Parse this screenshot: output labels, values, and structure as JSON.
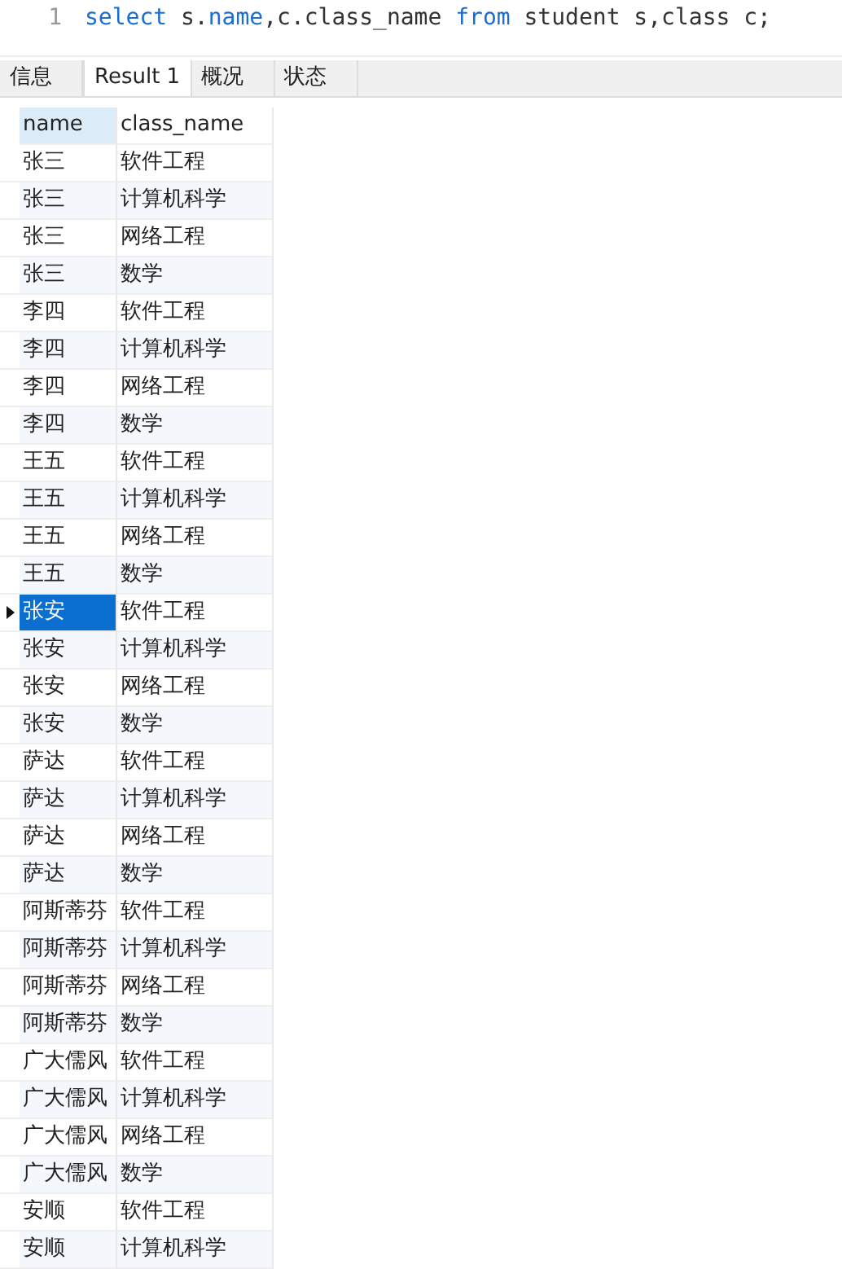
{
  "editor": {
    "line_number": "1",
    "code": [
      {
        "kind": "keyword",
        "text": "select"
      },
      {
        "kind": "plain",
        "text": " s."
      },
      {
        "kind": "keyword",
        "text": "name"
      },
      {
        "kind": "plain",
        "text": ",c.class_name "
      },
      {
        "kind": "keyword",
        "text": "from"
      },
      {
        "kind": "plain",
        "text": " student s,"
      },
      {
        "kind": "plain",
        "text": "class c;"
      }
    ]
  },
  "tabs": [
    {
      "label": "信息",
      "selected": false
    },
    {
      "label": "Result 1",
      "selected": true
    },
    {
      "label": "概况",
      "selected": false
    },
    {
      "label": "状态",
      "selected": false
    }
  ],
  "table": {
    "columns": [
      "name",
      "class_name"
    ],
    "rows": [
      {
        "name": "张三",
        "class_name": "软件工程",
        "selected": false
      },
      {
        "name": "张三",
        "class_name": "计算机科学",
        "selected": false
      },
      {
        "name": "张三",
        "class_name": "网络工程",
        "selected": false
      },
      {
        "name": "张三",
        "class_name": "数学",
        "selected": false
      },
      {
        "name": "李四",
        "class_name": "软件工程",
        "selected": false
      },
      {
        "name": "李四",
        "class_name": "计算机科学",
        "selected": false
      },
      {
        "name": "李四",
        "class_name": "网络工程",
        "selected": false
      },
      {
        "name": "李四",
        "class_name": "数学",
        "selected": false
      },
      {
        "name": "王五",
        "class_name": "软件工程",
        "selected": false
      },
      {
        "name": "王五",
        "class_name": "计算机科学",
        "selected": false
      },
      {
        "name": "王五",
        "class_name": "网络工程",
        "selected": false
      },
      {
        "name": "王五",
        "class_name": "数学",
        "selected": false
      },
      {
        "name": "张安",
        "class_name": "软件工程",
        "selected": true
      },
      {
        "name": "张安",
        "class_name": "计算机科学",
        "selected": false
      },
      {
        "name": "张安",
        "class_name": "网络工程",
        "selected": false
      },
      {
        "name": "张安",
        "class_name": "数学",
        "selected": false
      },
      {
        "name": "萨达",
        "class_name": "软件工程",
        "selected": false
      },
      {
        "name": "萨达",
        "class_name": "计算机科学",
        "selected": false
      },
      {
        "name": "萨达",
        "class_name": "网络工程",
        "selected": false
      },
      {
        "name": "萨达",
        "class_name": "数学",
        "selected": false
      },
      {
        "name": "阿斯蒂芬",
        "class_name": "软件工程",
        "selected": false
      },
      {
        "name": "阿斯蒂芬",
        "class_name": "计算机科学",
        "selected": false
      },
      {
        "name": "阿斯蒂芬",
        "class_name": "网络工程",
        "selected": false
      },
      {
        "name": "阿斯蒂芬",
        "class_name": "数学",
        "selected": false
      },
      {
        "name": "广大儒风",
        "class_name": "软件工程",
        "selected": false
      },
      {
        "name": "广大儒风",
        "class_name": "计算机科学",
        "selected": false
      },
      {
        "name": "广大儒风",
        "class_name": "网络工程",
        "selected": false
      },
      {
        "name": "广大儒风",
        "class_name": "数学",
        "selected": false
      },
      {
        "name": "安顺",
        "class_name": "软件工程",
        "selected": false
      },
      {
        "name": "安顺",
        "class_name": "计算机科学",
        "selected": false
      }
    ]
  }
}
